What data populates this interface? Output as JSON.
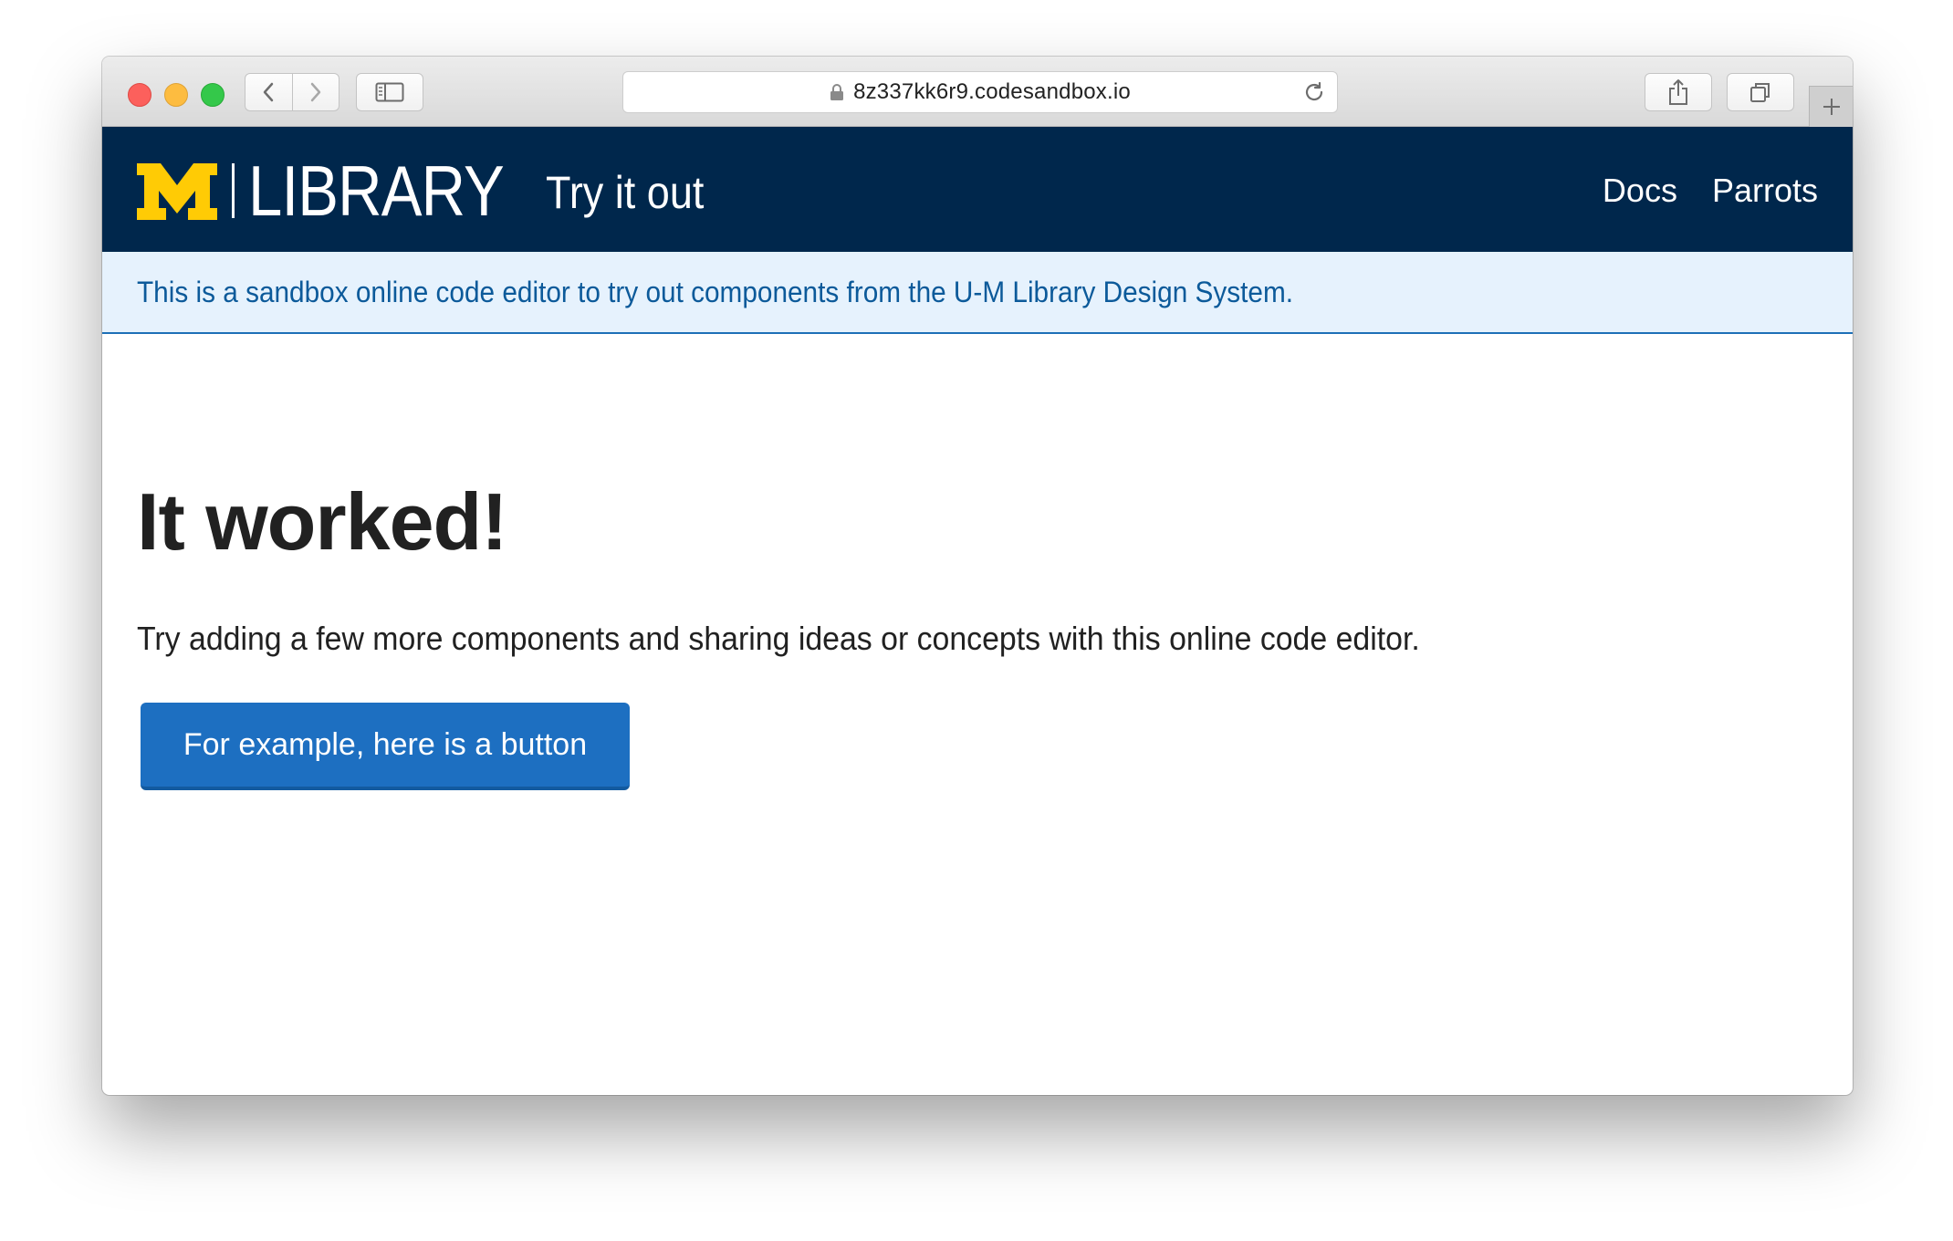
{
  "browser": {
    "url": "8z337kk6r9.codesandbox.io",
    "icons": {
      "back": "chevron-left-icon",
      "forward": "chevron-right-icon",
      "sidebar": "sidebar-icon",
      "lock": "lock-icon",
      "reload": "reload-icon",
      "share": "share-icon",
      "tabs": "tabs-overview-icon",
      "new_tab": "plus-icon"
    }
  },
  "header": {
    "logo_mark": "M",
    "logo_text": "LIBRARY",
    "site_title": "Try it out",
    "nav": [
      {
        "label": "Docs"
      },
      {
        "label": "Parrots"
      }
    ],
    "colors": {
      "background": "#00274c",
      "logo_maize": "#ffcb05"
    }
  },
  "banner": {
    "text": "This is a sandbox online code editor to try out components from the U-M Library Design System."
  },
  "main": {
    "heading": "It worked!",
    "paragraph": "Try adding a few more components and sharing ideas or concepts with this online code editor.",
    "button_label": "For example, here is a button",
    "button_color": "#1d6fc1"
  }
}
